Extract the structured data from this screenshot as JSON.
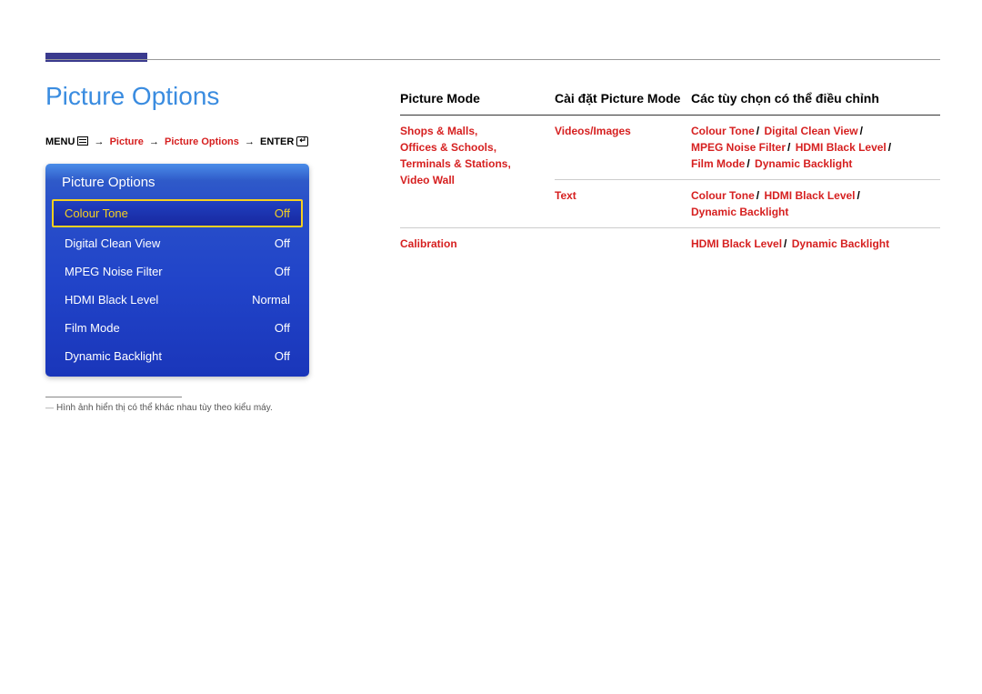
{
  "header": {
    "section_title": "Picture Options"
  },
  "breadcrumb": {
    "menu": "MENU",
    "step1": "Picture",
    "step2": "Picture Options",
    "enter": "ENTER"
  },
  "osd": {
    "title": "Picture Options",
    "items": [
      {
        "label": "Colour Tone",
        "value": "Off"
      },
      {
        "label": "Digital Clean View",
        "value": "Off"
      },
      {
        "label": "MPEG Noise Filter",
        "value": "Off"
      },
      {
        "label": "HDMI Black Level",
        "value": "Normal"
      },
      {
        "label": "Film Mode",
        "value": "Off"
      },
      {
        "label": "Dynamic Backlight",
        "value": "Off"
      }
    ]
  },
  "footnote": "Hình ảnh hiển thị có thể khác nhau tùy theo kiểu máy.",
  "table": {
    "headers": {
      "col1": "Picture Mode",
      "col2": "Cài đặt Picture Mode",
      "col3": "Các tùy chọn có thể điều chỉnh"
    },
    "rows": [
      {
        "mode_items": [
          "Shops & Malls",
          "Offices & Schools",
          "Terminals & Stations",
          "Video Wall"
        ],
        "setting": "Videos/Images",
        "options": [
          "Colour Tone",
          "Digital Clean View",
          "MPEG Noise Filter",
          "HDMI Black Level",
          "Film Mode",
          "Dynamic Backlight"
        ]
      },
      {
        "setting": "Text",
        "options": [
          "Colour Tone",
          "HDMI Black Level",
          "Dynamic Backlight"
        ]
      },
      {
        "mode_items": [
          "Calibration"
        ],
        "setting": "",
        "options": [
          "HDMI Black Level",
          "Dynamic Backlight"
        ]
      }
    ]
  }
}
